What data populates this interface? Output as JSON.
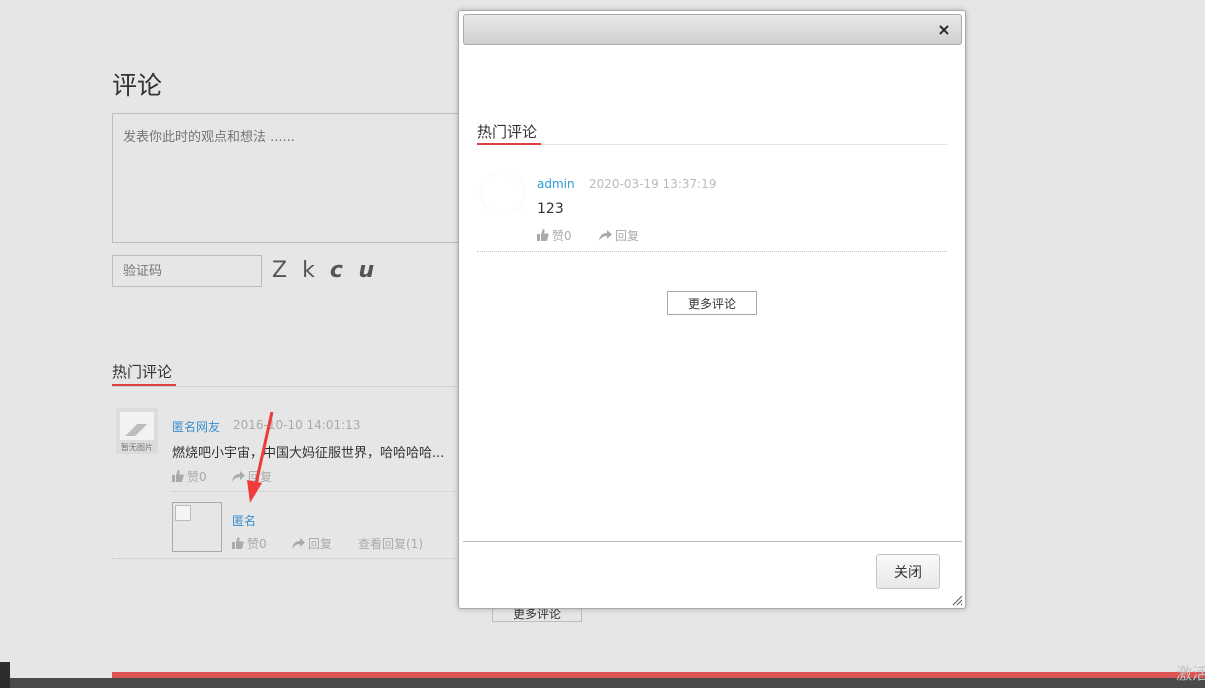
{
  "background": {
    "title": "评论",
    "textarea_placeholder": "发表你此时的观点和想法 ......",
    "captcha_placeholder": "验证码",
    "captcha_text_plain": "Z k ",
    "captcha_text_bold": "c u",
    "hot_title": "热门评论",
    "comment": {
      "avatar_caption": "暂无图片",
      "user": "匿名网友",
      "time": "2016-10-10 14:01:13",
      "content": "燃烧吧小宇宙，中国大妈征服世界，哈哈哈哈...",
      "like": "赞0",
      "reply": "回复"
    },
    "sub_comment": {
      "user": "匿名",
      "like": "赞0",
      "reply": "回复",
      "view_replies": "查看回复(1)"
    },
    "more_button": "更多评论",
    "watermark": "激活"
  },
  "modal": {
    "hot_title": "热门评论",
    "comment": {
      "user": "admin",
      "time": "2020-03-19 13:37:19",
      "content": "123",
      "like": "赞0",
      "reply": "回复"
    },
    "more_button": "更多评论",
    "close_button": "关闭",
    "close_icon": "×"
  },
  "colors": {
    "accent_red": "#e0403f",
    "link_blue": "#2a9bd8",
    "arrow_red": "#f03a3a"
  }
}
